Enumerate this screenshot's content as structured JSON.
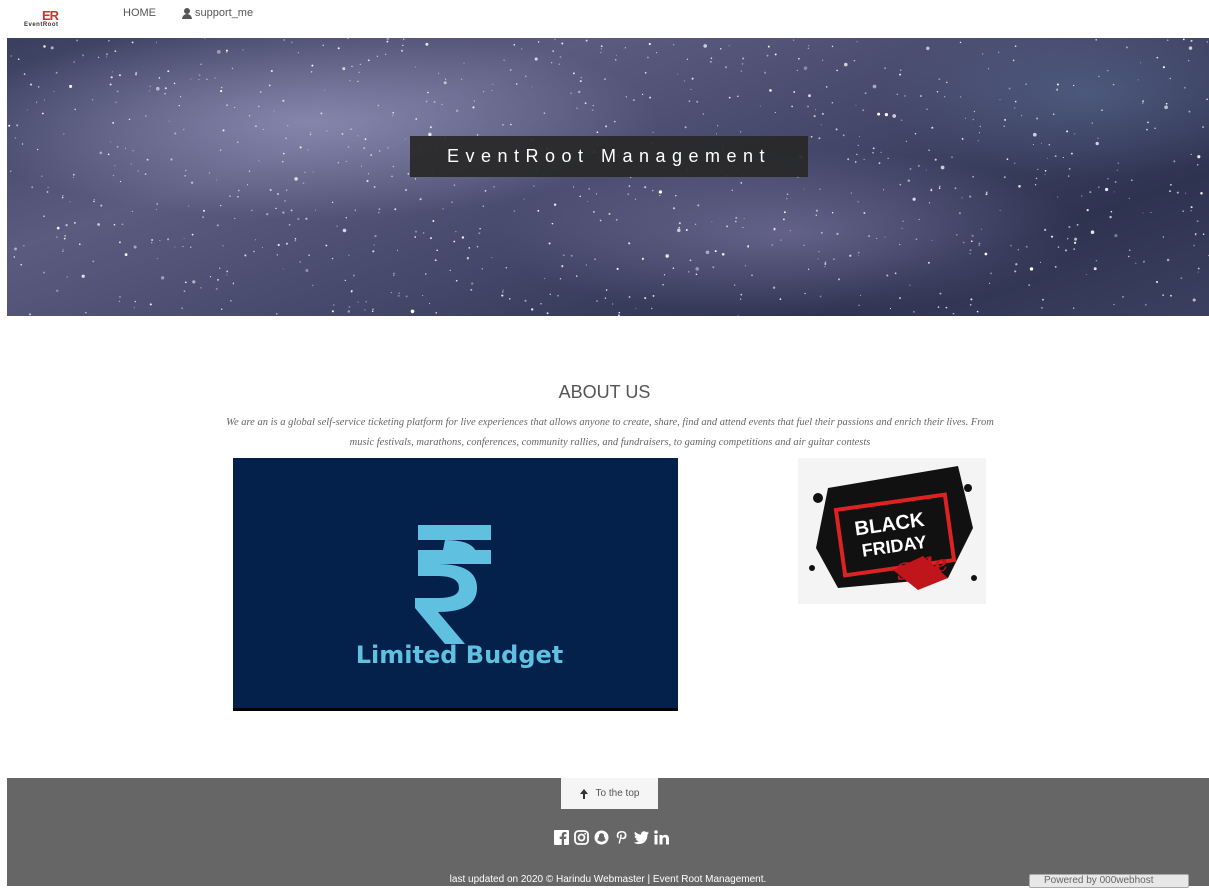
{
  "nav": {
    "logo_mark": "ER",
    "logo_text": "EventRoot",
    "home": "HOME",
    "support": "support_me"
  },
  "hero": {
    "title": "EventRoot Management"
  },
  "about": {
    "title": "ABOUT US",
    "text": "We are an is a global self-service ticketing platform for live experiences that allows anyone to create, share, find and attend events that fuel their passions and enrich their lives. From music festivals, marathons, conferences, community rallies, and fundraisers, to gaming competitions and air guitar contests"
  },
  "images": {
    "budget_symbol": "₹",
    "budget_label": "Limited Budget",
    "friday_line1": "BLACK",
    "friday_line2": "FRIDAY",
    "friday_line3": "Sale"
  },
  "footer": {
    "to_top": "To the top",
    "social_icons": [
      "facebook-icon",
      "instagram-icon",
      "snapchat-icon",
      "pinterest-icon",
      "twitter-icon",
      "linkedin-icon"
    ],
    "copyright": "last updated on 2020 © Harindu Webmaster | Event Root Management.",
    "powered": "Powered by 000webhost"
  },
  "colors": {
    "footer_bg": "#666666",
    "budget_bg": "#03214b",
    "budget_accent": "#5fc0e0",
    "logo_red": "#c0392b"
  }
}
